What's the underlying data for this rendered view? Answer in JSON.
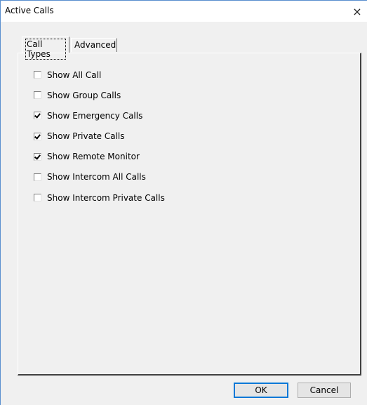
{
  "window": {
    "title": "Active Calls",
    "close_icon": "×"
  },
  "tabs": [
    {
      "label": "Call Types",
      "selected": true
    },
    {
      "label": "Advanced",
      "selected": false
    }
  ],
  "call_types": {
    "items": [
      {
        "label": "Show All Call",
        "checked": false
      },
      {
        "label": "Show Group Calls",
        "checked": false
      },
      {
        "label": "Show Emergency Calls",
        "checked": true
      },
      {
        "label": "Show Private Calls",
        "checked": true
      },
      {
        "label": "Show Remote Monitor",
        "checked": true
      },
      {
        "label": "Show Intercom All Calls",
        "checked": false
      },
      {
        "label": "Show Intercom Private Calls",
        "checked": false
      }
    ]
  },
  "buttons": {
    "ok_label": "OK",
    "cancel_label": "Cancel"
  }
}
